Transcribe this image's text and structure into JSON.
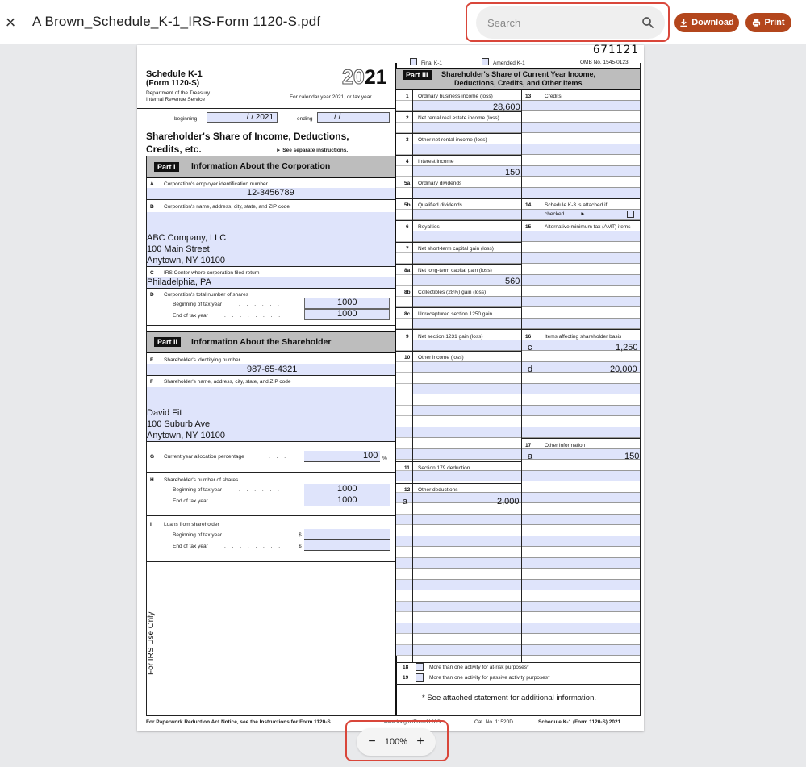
{
  "app": {
    "title": "A Brown_Schedule_K-1_IRS-Form 1120-S.pdf",
    "search_placeholder": "Search",
    "download_label": "Download",
    "print_label": "Print",
    "zoom_level": "100%",
    "zoom_out_label": "−",
    "zoom_in_label": "+",
    "close_label": "×",
    "accent_color": "#b3461c",
    "highlight_color": "#d9463a"
  },
  "form": {
    "code_number": "671121",
    "final_k1": "Final K-1",
    "amended_k1": "Amended K-1",
    "omb": "OMB No. 1545-0123",
    "title": "Schedule K-1",
    "subtitle": "(Form 1120-S)",
    "dept1": "Department of the Treasury",
    "dept2": "Internal Revenue Service",
    "year_light": "20",
    "year_bold": "21",
    "cal_year": "For calendar year 2021, or tax year",
    "beginning": "beginning",
    "beginning_val": "/      /   2021",
    "ending": "ending",
    "ending_val": "/      /",
    "heading1": "Shareholder's Share of Income, Deductions,",
    "heading2": "Credits, etc.",
    "see_sep": "► See separate instructions.",
    "part1_label": "Part I",
    "part1_title": "Information About the Corporation",
    "a_letter": "A",
    "a_label": "Corporation's employer identification number",
    "a_val": "12-3456789",
    "b_letter": "B",
    "b_label": "Corporation's name, address, city, state, and ZIP code",
    "b_line1": "ABC Company, LLC",
    "b_line2": "100 Main Street",
    "b_line3": "Anytown, NY  10100",
    "c_letter": "C",
    "c_label": "IRS Center where corporation filed return",
    "c_val": "Philadelphia, PA",
    "d_letter": "D",
    "d_label": "Corporation's total number of shares",
    "d_begin": "Beginning of tax year",
    "d_end": "End of tax year",
    "d_begin_val": "1000",
    "d_end_val": "1000",
    "part2_label": "Part II",
    "part2_title": "Information About the Shareholder",
    "e_letter": "E",
    "e_label": "Shareholder's identifying number",
    "e_val": "987-65-4321",
    "f_letter": "F",
    "f_label": "Shareholder's name, address, city, state, and ZIP code",
    "f_line1": "David Fit",
    "f_line2": "100 Suburb Ave",
    "f_line3": "Anytown, NY 10100",
    "g_letter": "G",
    "g_label": "Current year allocation percentage",
    "g_val": "100",
    "g_pct": "%",
    "h_letter": "H",
    "h_label": "Shareholder's number of shares",
    "h_begin": "Beginning of tax year",
    "h_end": "End of tax year",
    "h_begin_val": "1000",
    "h_end_val": "1000",
    "i_letter": "I",
    "i_label": "Loans from shareholder",
    "i_begin": "Beginning of tax year",
    "i_end": "End of tax year",
    "dollar": "$",
    "irs_use": "For IRS Use Only",
    "part3_label": "Part III",
    "part3_title1": "Shareholder's Share of Current Year Income,",
    "part3_title2": "Deductions, Credits, and Other Items",
    "l1": "Ordinary business income (loss)",
    "l1_val": "28,600",
    "l2": "Net rental real estate income (loss)",
    "l3": "Other net rental income (loss)",
    "l4": "Interest income",
    "l4_val": "150",
    "l5a": "Ordinary dividends",
    "l5b": "Qualified dividends",
    "l6": "Royalties",
    "l7": "Net short-term capital gain (loss)",
    "l8a": "Net long-term capital gain (loss)",
    "l8a_val": "560",
    "l8b": "Collectibles (28%) gain (loss)",
    "l8c": "Unrecaptured section 1250 gain",
    "l9": "Net section 1231 gain (loss)",
    "l10": "Other income (loss)",
    "l11": "Section 179 deduction",
    "l12": "Other deductions",
    "l12_code": "a",
    "l12_val": "2,000",
    "l13": "Credits",
    "l14a": "Schedule K-3 is attached if",
    "l14b": "checked  .   .   .   .   .   ►",
    "l15": "Alternative minimum tax (AMT) items",
    "l16": "Items affecting shareholder basis",
    "l16_c": "c",
    "l16_c_val": "1,250",
    "l16_d": "d",
    "l16_d_val": "20,000",
    "l17": "Other information",
    "l17_a": "a",
    "l17_a_val": "150",
    "l18": "More than one activity for at-risk purposes*",
    "l19": "More than one activity for passive activity purposes*",
    "attached": "* See attached statement for additional information.",
    "n1": "1",
    "n2": "2",
    "n3": "3",
    "n4": "4",
    "n5a": "5a",
    "n5b": "5b",
    "n6": "6",
    "n7": "7",
    "n8a": "8a",
    "n8b": "8b",
    "n8c": "8c",
    "n9": "9",
    "n10": "10",
    "n11": "11",
    "n12": "12",
    "n13": "13",
    "n14": "14",
    "n15": "15",
    "n16": "16",
    "n17": "17",
    "n18": "18",
    "n19": "19",
    "footer_left": "For Paperwork Reduction Act Notice, see the Instructions for Form 1120-S.",
    "footer_url": "www.irs.gov/Form1120S",
    "footer_cat": "Cat. No. 11520D",
    "footer_right": "Schedule K-1 (Form 1120-S) 2021"
  }
}
